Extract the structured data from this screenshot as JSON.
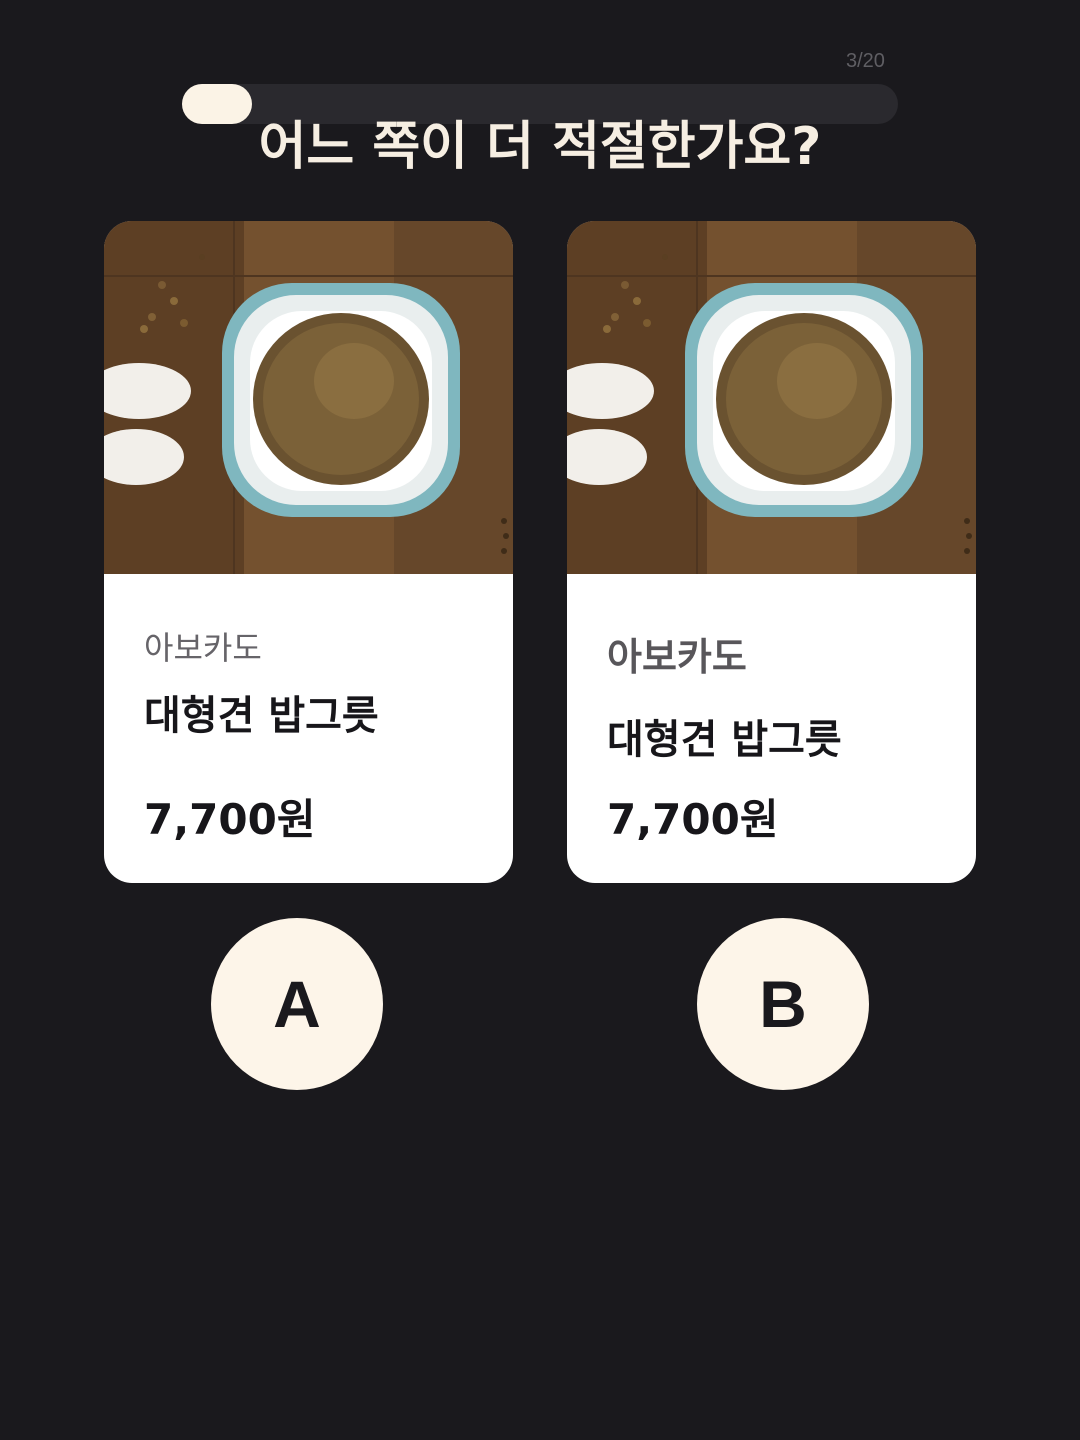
{
  "progress": {
    "label": "3/20",
    "fraction": 0.15
  },
  "question": "어느 쪽이 더 적절한가요?",
  "options": [
    {
      "brand": "아보카도",
      "name": "대형견 밥그릇",
      "price": "7,700원",
      "image": "dog-food-bowl-photo"
    },
    {
      "brand": "아보카도",
      "name": "대형견 밥그릇",
      "price": "7,700원",
      "image": "dog-food-bowl-photo"
    }
  ],
  "choices": [
    {
      "label": "A"
    },
    {
      "label": "B"
    }
  ],
  "colors": {
    "background": "#1a191d",
    "accent": "#fdf5e9",
    "card": "#ffffff"
  }
}
